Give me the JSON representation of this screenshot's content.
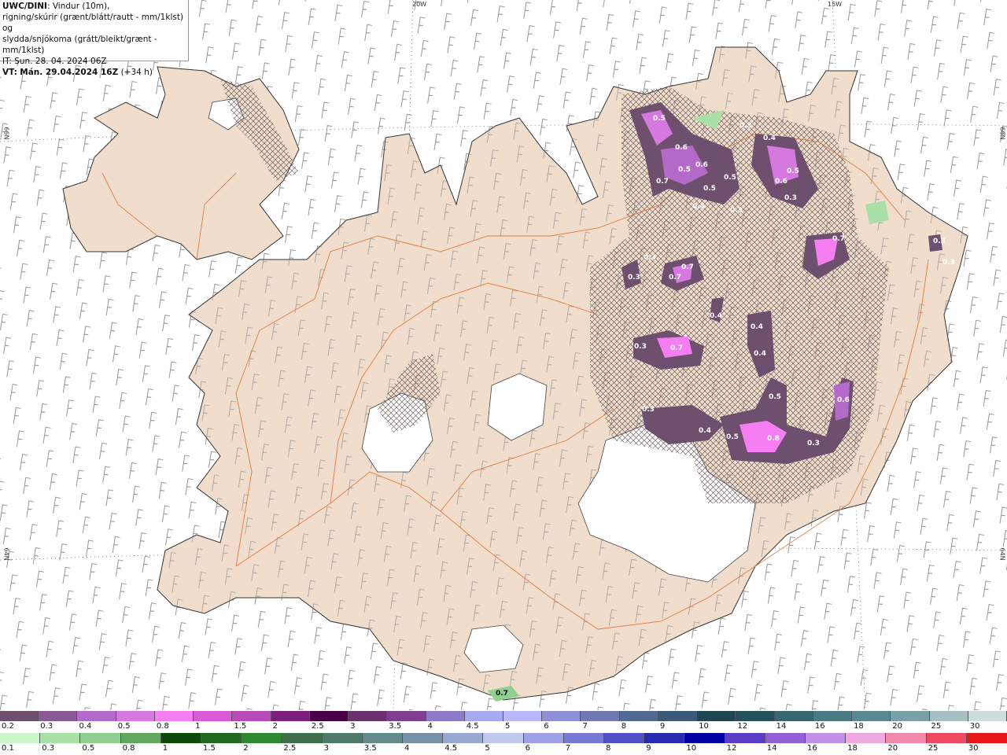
{
  "header": {
    "model": "UWC/DINI",
    "title_rest": ": Vindur (10m),",
    "line2": "rigning/skúrir (grænt/blátt/rautt - mm/1klst) og",
    "line3": "slydda/snjókoma (grátt/bleikt/grænt - mm/1klst)",
    "it": "IT: Sun. 28. 04. 2024 06Z",
    "vt_label": "VT:",
    "vt_value": "Mán. 29.04.2024 16Z",
    "vt_lead": "(+34 h)"
  },
  "coords": {
    "top_20w": "20W",
    "top_15w": "15W",
    "left_66n": "66N",
    "right_66n": "66N",
    "left_64n": "64N",
    "right_64n": "64N"
  },
  "precip_labels": [
    "0.5",
    "0.6",
    "0.5",
    "0.6",
    "0.7",
    "0.5",
    "0.5",
    "0.4",
    "0.3",
    "0.3",
    "0.4",
    "0.6",
    "0.5",
    "0.3",
    "0.7",
    "0.3",
    "0.3",
    "0.7",
    "0.3",
    "0.3",
    "0.7",
    "0.4",
    "0.4",
    "0.4",
    "0.3",
    "0.7",
    "0.5",
    "0.6",
    "0.3",
    "0.4",
    "0.5",
    "0.8",
    "0.3",
    "0.7"
  ],
  "legend_snow": {
    "labels": [
      "0.2",
      "0.3",
      "0.4",
      "0.5",
      "0.8",
      "1",
      "1.5",
      "2",
      "2.5",
      "3",
      "3.5",
      "4",
      "4.5",
      "5",
      "6",
      "7",
      "8",
      "9",
      "10",
      "12",
      "14",
      "16",
      "18",
      "20",
      "25",
      "30"
    ],
    "colors": [
      "#6e4f6e",
      "#8a5a96",
      "#b46ac8",
      "#d578e0",
      "#f47ef2",
      "#d85ad6",
      "#b94ab9",
      "#7d1d7c",
      "#4a0046",
      "#6b2f6b",
      "#7f3e90",
      "#9078c8",
      "#a8a8f0",
      "#b8b8f8",
      "#9090d8",
      "#6f78b0",
      "#506a94",
      "#3c5a78",
      "#1e4650",
      "#24505a",
      "#3a6670",
      "#4a7a84",
      "#5a8890",
      "#7aa0a8",
      "#a8c0c4",
      "#d0dcdc"
    ]
  },
  "legend_rain": {
    "labels": [
      "0.1",
      "0.3",
      "0.5",
      "0.8",
      "1",
      "1.5",
      "2",
      "2.5",
      "3",
      "3.5",
      "4",
      "4.5",
      "5",
      "6",
      "7",
      "8",
      "9",
      "10",
      "12",
      "14",
      "16",
      "18",
      "20",
      "25",
      "30"
    ],
    "colors": [
      "#ccf6cc",
      "#a8e0a8",
      "#8fcf8f",
      "#5ea85e",
      "#0a4a0a",
      "#1e6a1e",
      "#2e8a2e",
      "#3f6e4a",
      "#507a68",
      "#648a88",
      "#7890a8",
      "#98a8d0",
      "#c0c8f0",
      "#a0a0e8",
      "#7878d8",
      "#5050c8",
      "#2828b0",
      "#0000a0",
      "#5a3cc8",
      "#9060d8",
      "#c090e8",
      "#f0a8e0",
      "#f08aa8",
      "#f04860",
      "#e81818"
    ]
  }
}
